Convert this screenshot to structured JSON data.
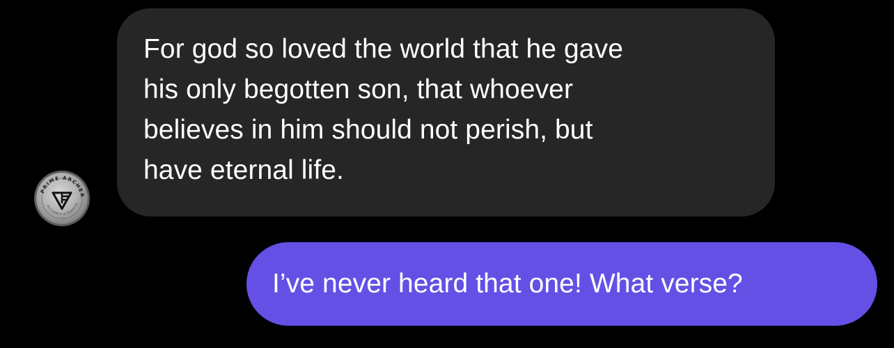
{
  "conversation": {
    "incoming": {
      "sender_avatar": {
        "icon": "prime-archery-logo-icon",
        "logo_text": "PRIME ARCHERY",
        "logo_subtext": "ACCURACY IS EVERYTHING",
        "colors": {
          "ring": "#8a8a8a",
          "face": "#b5b5b5",
          "text": "#1a1a1a"
        }
      },
      "lines": [
        "For god so loved the world that he gave",
        "his only begotten son, that whoever",
        "believes in him should not perish, but",
        "have eternal life."
      ],
      "bubble_color": "#262626"
    },
    "outgoing": {
      "text": "I’ve never heard that one! What verse?",
      "bubble_color": "#6550e6"
    },
    "background_color": "#000000"
  }
}
